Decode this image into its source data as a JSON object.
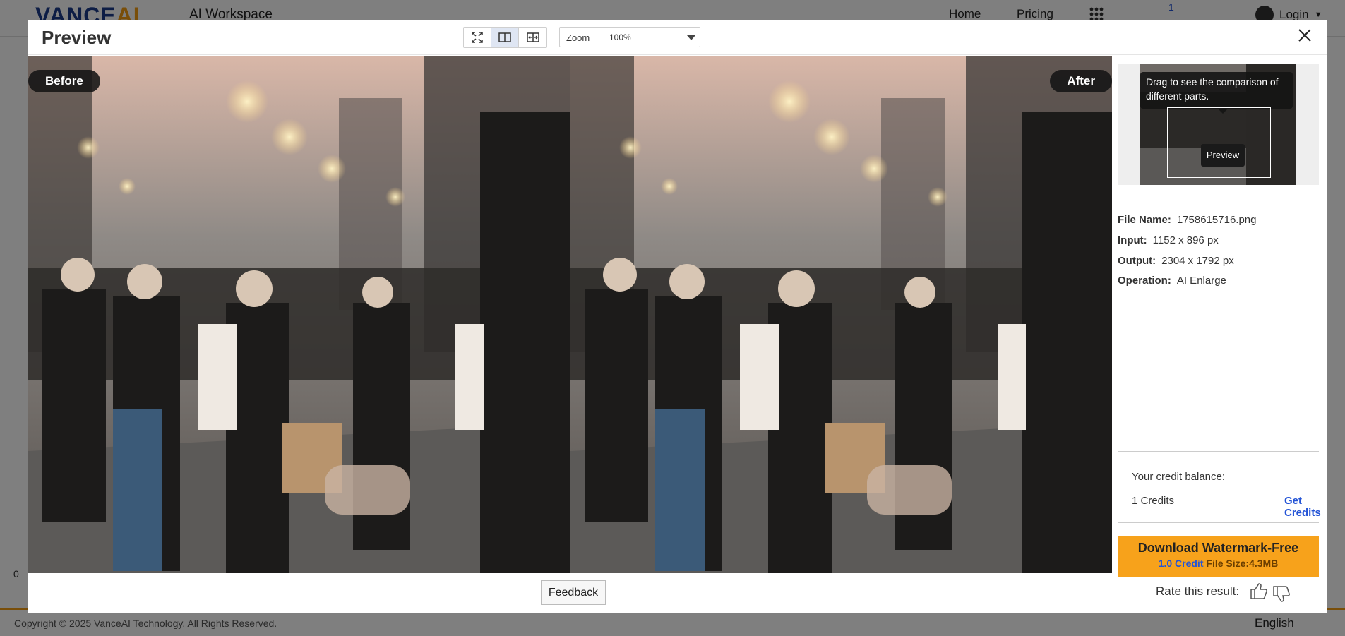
{
  "background": {
    "logo": {
      "part1": "VANCE",
      "part2": "AI"
    },
    "workspace": "AI Workspace",
    "nav": [
      "Home",
      "Pricing"
    ],
    "badge": "1",
    "login": "Login",
    "copyright": "Copyright © 2025 VanceAI Technology. All Rights Reserved.",
    "language": "English",
    "count": "0"
  },
  "modal": {
    "title": "Preview",
    "zoom_label": "Zoom",
    "zoom_value": "100%",
    "before_label": "Before",
    "after_label": "After",
    "tooltip": "Drag to see the comparison of different parts.",
    "thumb_preview": "Preview",
    "meta": [
      {
        "key": "File Name:",
        "value": "1758615716.png"
      },
      {
        "key": "Input:",
        "value": "1152 x 896 px"
      },
      {
        "key": "Output:",
        "value": "2304 x 1792 px"
      },
      {
        "key": "Operation:",
        "value": "AI Enlarge"
      }
    ],
    "credit_label": "Your credit balance:",
    "credit_value": "1 Credits",
    "get_credits": "Get Credits",
    "download_main": "Download Watermark-Free",
    "download_credit": "1.0 Credit",
    "download_size": "File Size:4.3MB",
    "feedback": "Feedback",
    "rate_label": "Rate this result:"
  },
  "colors": {
    "accent": "#f7a21b",
    "link": "#2454d6"
  }
}
